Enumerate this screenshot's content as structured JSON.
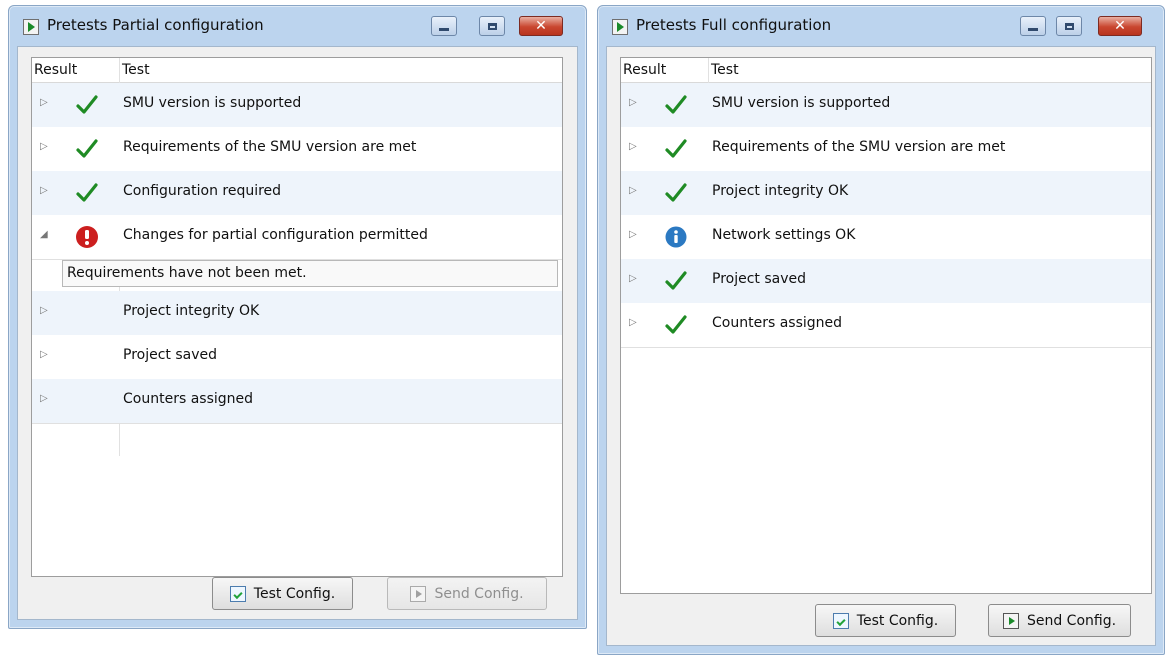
{
  "windows": {
    "partial": {
      "title": "Pretests Partial configuration",
      "columns": {
        "result": "Result",
        "test": "Test"
      },
      "rows": [
        {
          "label": "SMU version is supported",
          "status": "check-icon",
          "expander": "▷"
        },
        {
          "label": "Requirements of the SMU version are met",
          "status": "check-icon",
          "expander": "▷"
        },
        {
          "label": "Configuration required",
          "status": "check-icon",
          "expander": "▷"
        },
        {
          "label": "Changes for partial configuration permitted",
          "status": "error-icon",
          "expander": "◢",
          "expanded": true
        },
        {
          "label": "Project integrity OK",
          "status": "none",
          "expander": "▷"
        },
        {
          "label": "Project saved",
          "status": "none",
          "expander": "▷"
        },
        {
          "label": "Counters assigned",
          "status": "none",
          "expander": "▷"
        }
      ],
      "detail_text": "Requirements have not been met.",
      "buttons": {
        "test_config": "Test Config.",
        "send_config": "Send Config."
      }
    },
    "full": {
      "title": "Pretests Full configuration",
      "columns": {
        "result": "Result",
        "test": "Test"
      },
      "rows": [
        {
          "label": "SMU version is supported",
          "status": "check-icon",
          "expander": "▷"
        },
        {
          "label": "Requirements of the SMU version are met",
          "status": "check-icon",
          "expander": "▷"
        },
        {
          "label": "Project integrity OK",
          "status": "check-icon",
          "expander": "▷"
        },
        {
          "label": "Network settings OK",
          "status": "info-icon",
          "expander": "▷"
        },
        {
          "label": "Project saved",
          "status": "check-icon",
          "expander": "▷"
        },
        {
          "label": "Counters assigned",
          "status": "check-icon",
          "expander": "▷"
        }
      ],
      "buttons": {
        "test_config": "Test Config.",
        "send_config": "Send Config."
      }
    }
  },
  "window_controls": {
    "close_glyph": "✕"
  },
  "colors": {
    "check": "#1f8b24",
    "error": "#cc1f1f",
    "info": "#2b79c2",
    "row_tint": "#eef4fb"
  }
}
